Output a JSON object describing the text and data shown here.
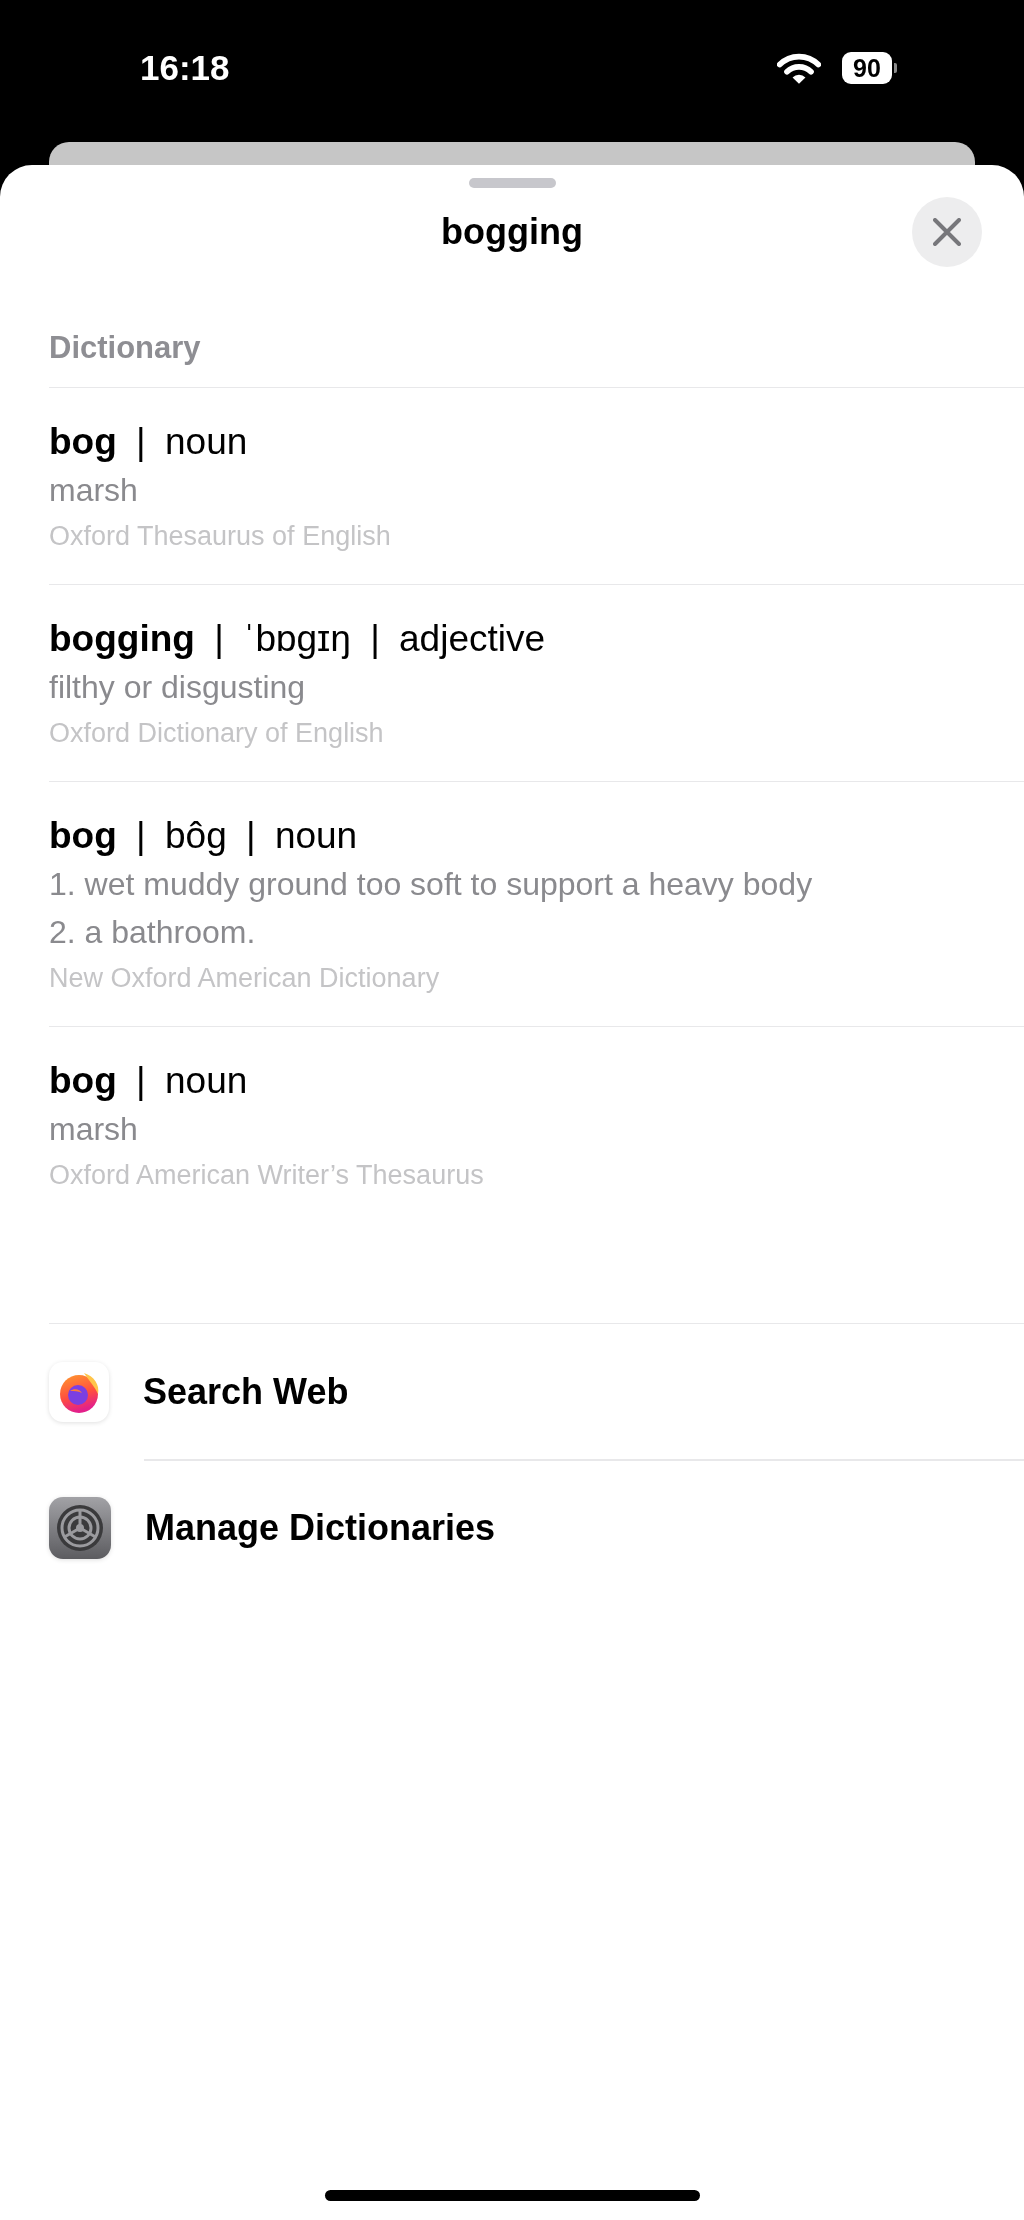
{
  "status_bar": {
    "time": "16:18",
    "battery": "90"
  },
  "sheet": {
    "title": "bogging",
    "section_title": "Dictionary"
  },
  "entries": [
    {
      "heading": "**bog** | noun",
      "definitions": [
        "marsh"
      ],
      "source": "Oxford Thesaurus of English"
    },
    {
      "heading": "**bogging** | ˈbɒgɪŋ | adjective",
      "definitions": [
        "filthy or disgusting"
      ],
      "source": "Oxford Dictionary of English"
    },
    {
      "heading": "**bog** | bôg | noun",
      "definitions": [
        "1. wet muddy ground too soft to support a heavy body",
        "2. a bathroom."
      ],
      "source": "New Oxford American Dictionary"
    },
    {
      "heading": "**bog** | noun",
      "definitions": [
        "marsh"
      ],
      "source": "Oxford American Writer’s Thesaurus"
    }
  ],
  "actions": [
    {
      "kind": "web",
      "label": "Search Web"
    },
    {
      "kind": "settings",
      "label": "Manage Dictionaries"
    }
  ]
}
